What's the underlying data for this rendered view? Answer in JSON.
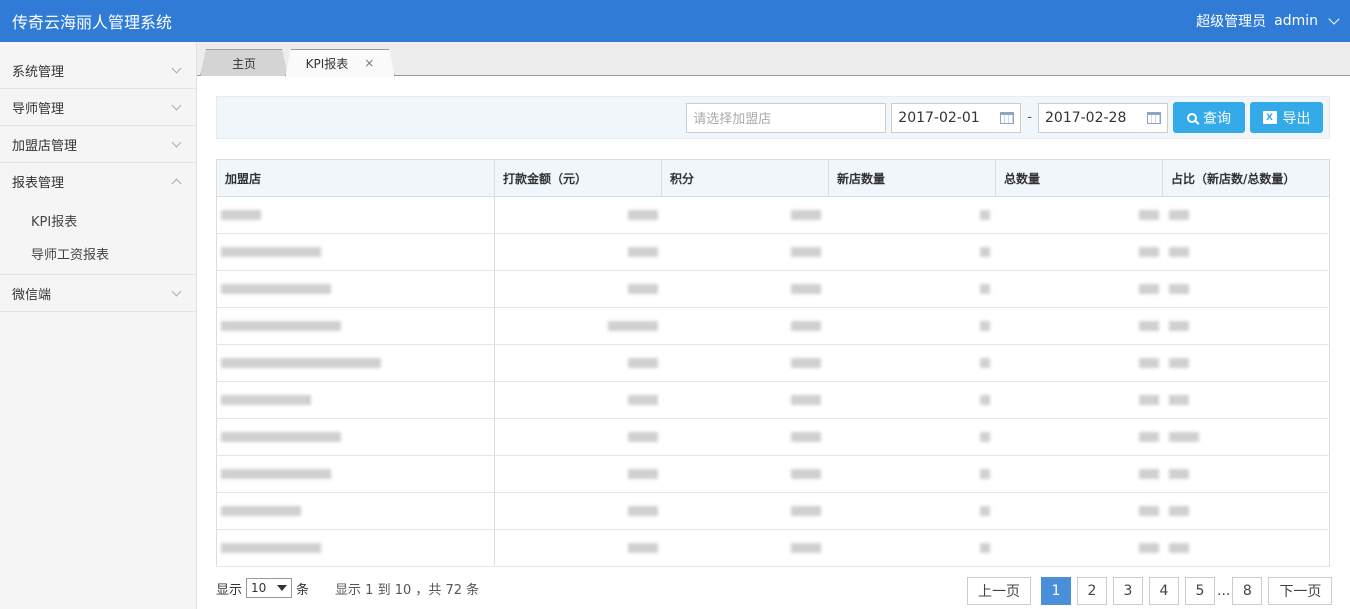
{
  "header": {
    "title": "传奇云海丽人管理系统",
    "role": "超级管理员",
    "username": "admin"
  },
  "sidebar": {
    "items": [
      {
        "label": "系统管理"
      },
      {
        "label": "导师管理"
      },
      {
        "label": "加盟店管理"
      },
      {
        "label": "报表管理"
      },
      {
        "label": "微信端"
      }
    ],
    "sub_items": [
      {
        "label": "KPI报表"
      },
      {
        "label": "导师工资报表"
      }
    ]
  },
  "tabs": {
    "home": "主页",
    "kpi": "KPI报表",
    "close": "×"
  },
  "filter": {
    "shop_placeholder": "请选择加盟店",
    "start_date": "2017-02-01",
    "separator": "-",
    "end_date": "2017-02-28",
    "query_label": "查询",
    "export_label": "导出"
  },
  "table": {
    "headers": [
      "加盟店",
      "打款金额（元）",
      "积分",
      "新店数量",
      "总数量",
      "占比（新店数/总数量）"
    ]
  },
  "footer": {
    "show_label": "显示",
    "page_size": "10",
    "unit_label": "条",
    "info": "显示 1 到 10 ，共 72 条"
  },
  "pagination": {
    "prev": "上一页",
    "pages": [
      "1",
      "2",
      "3",
      "4",
      "5"
    ],
    "ellipsis": "...",
    "last": "8",
    "next": "下一页"
  }
}
